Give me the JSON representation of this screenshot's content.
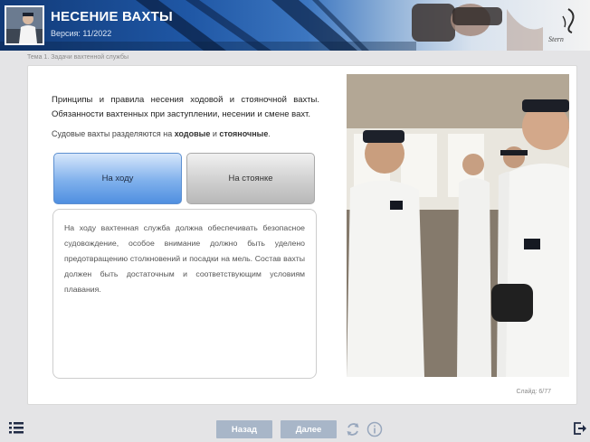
{
  "header": {
    "title": "НЕСЕНИЕ ВАХТЫ",
    "version": "Версия: 11/2022",
    "logo_text": "Stern"
  },
  "breadcrumb": "Тема 1. Задачи вахтенной службы",
  "content": {
    "intro": "Принципы и правила несения ходовой и стояночной вахты. Обязанности вахтенных при заступлении, несении и смене вахт.",
    "subtitle_prefix": "Судовые вахты разделяются на ",
    "subtitle_term1": "ходовые",
    "subtitle_mid": " и ",
    "subtitle_term2": "стояночные",
    "subtitle_suffix": ".",
    "tabs": [
      {
        "label": "На ходу",
        "active": true
      },
      {
        "label": "На стоянке",
        "active": false
      }
    ],
    "panel_text": "На ходу вахтенная служба должна обеспечивать безопасное судовождение, особое внимание должно быть уделено предотвращению столкновений и посадки на мель. Состав вахты должен быть достаточным и соответствующим условиям плавания."
  },
  "pager": "Слайд: 6/77",
  "nav": {
    "prev": "Назад",
    "next": "Далее"
  },
  "icons": [
    "menu-icon",
    "reload-icon",
    "info-icon",
    "exit-icon"
  ],
  "colors": {
    "accent_blue": "#4f8fe0",
    "nav_button": "#a8b6c8",
    "header_dark": "#113a78"
  }
}
